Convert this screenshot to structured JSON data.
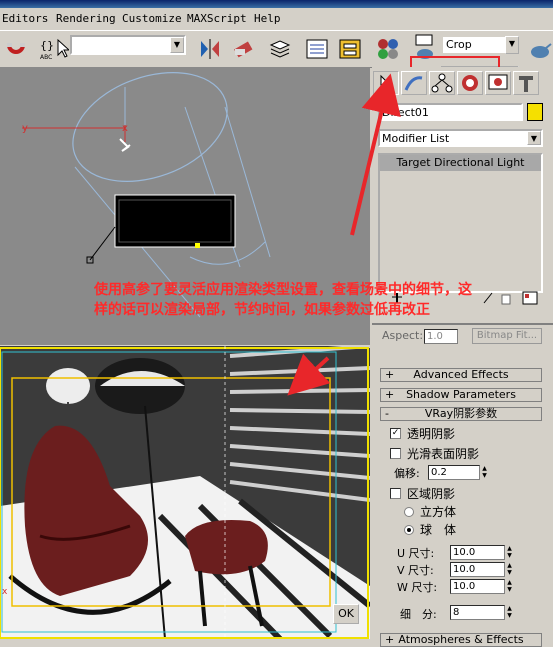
{
  "menu": {
    "items": [
      "Editors",
      "Rendering",
      "Customize",
      "MAXScript",
      "Help"
    ]
  },
  "toolbar": {
    "named_selection_value": "",
    "abc_label": "ABC",
    "render_type_value": "Crop"
  },
  "viewport_top": {
    "axis_y": "y",
    "axis_x": "x"
  },
  "command_panel": {
    "object_name": "Direct01",
    "object_color": "#f5e000",
    "modifier_list_label": "Modifier List",
    "stack_item": "Target Directional Light",
    "aspect_label": "Aspect:",
    "aspect_value": "1.0",
    "bitmap_fit_label": "Bitmap Fit...",
    "rollouts": {
      "advanced_effects": "Advanced Effects",
      "shadow_parameters": "Shadow Parameters",
      "vray_shadow_params": "VRay阴影参数",
      "atmospheres_effects": "Atmospheres & Effects"
    },
    "vray": {
      "transparent_shadows_label": "透明阴影",
      "transparent_shadows_checked": "✓",
      "smooth_surface_label": "光滑表面阴影",
      "bias_label": "偏移:",
      "bias_value": "0.2",
      "area_shadow_label": "区域阴影",
      "cube_label": "立方体",
      "sphere_label": "球　体",
      "u_size_label": "U 尺寸:",
      "u_size_value": "10.0",
      "v_size_label": "V 尺寸:",
      "v_size_value": "10.0",
      "w_size_label": "W 尺寸:",
      "w_size_value": "10.0",
      "subdivs_label": "细　分:",
      "subdivs_value": "8"
    }
  },
  "viewport_persp": {
    "corner_label": "x",
    "ok_label": "OK"
  },
  "annotation": {
    "text": "使用高参了要灵活应用渲染类型设置，查看场景中的细节，这样的话可以渲染局部，节约时间，如果参数过低再改正",
    "color": "#ff2a2a"
  },
  "highlight_color": "#e8262a",
  "crop_region_color": "#f0c000"
}
